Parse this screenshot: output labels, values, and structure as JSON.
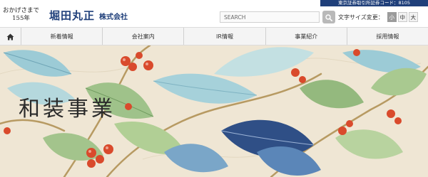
{
  "header": {
    "tagline_line1": "おかげさまで",
    "tagline_line2": "155年",
    "company_name": "堀田丸正",
    "company_kind": "株式会社",
    "stock_badge": "東京証券取引所証券コード：8105",
    "search_placeholder": "SEARCH",
    "font_size_label": "文字サイズ変更：",
    "font_sizes": [
      "小",
      "中",
      "大"
    ]
  },
  "nav": {
    "items": [
      "新着情報",
      "会社案内",
      "IR情報",
      "事業紹介",
      "採用情報"
    ]
  },
  "hero": {
    "title": "和装事業"
  },
  "icons": {
    "home": "home-icon",
    "search": "search-icon"
  },
  "colors": {
    "brand_navy": "#1f3f7a",
    "nav_bg": "#f4f4f4",
    "hero_bg": "#efe6d4"
  }
}
